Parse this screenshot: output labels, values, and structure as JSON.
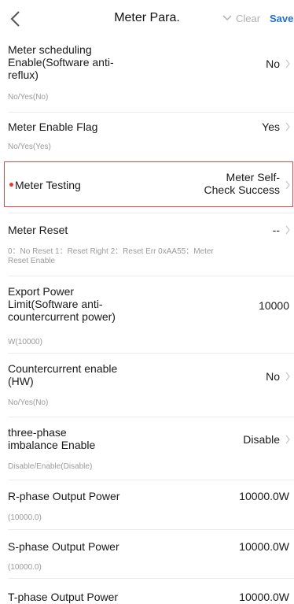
{
  "header": {
    "title": "Meter Para.",
    "clear_label": "Clear",
    "save_label": "Save",
    "back_icon": "chevron-left-icon",
    "dropdown_icon": "chevron-down-icon"
  },
  "rows": [
    {
      "label_lines": [
        "Meter scheduling",
        "Enable(Software anti-",
        "reflux)"
      ],
      "value": "No",
      "sub": "No/Yes(No)"
    },
    {
      "label_lines": [
        "Meter Enable Flag"
      ],
      "value": "Yes",
      "sub": "No/Yes(Yes)"
    },
    {
      "label_lines": [
        "Meter Testing"
      ],
      "value_lines": [
        "Meter Self-",
        "Check Success"
      ]
    },
    {
      "label_lines": [
        "Meter Reset"
      ],
      "value": "--",
      "sub_lines": [
        "0：No Reset 1：Reset Right  2：Reset Err 0xAA55：Meter",
        "Reset Enable"
      ]
    },
    {
      "label_lines": [
        "Export Power",
        "Limit(Software anti-",
        "countercurrent power)"
      ],
      "value": "10000",
      "sub": "W(10000)"
    },
    {
      "label_lines": [
        "Countercurrent enable",
        "(HW)"
      ],
      "value": "No",
      "sub": "No/Yes(No)"
    },
    {
      "label_lines": [
        "three-phase",
        "imbalance Enable"
      ],
      "value": "Disable",
      "sub": "Disable/Enable(Disable)"
    },
    {
      "label_lines": [
        "R-phase Output Power"
      ],
      "value": "10000.0W",
      "sub": "(10000.0)"
    },
    {
      "label_lines": [
        "S-phase Output Power"
      ],
      "value": "10000.0W",
      "sub": "(10000.0)"
    },
    {
      "label_lines": [
        "T-phase Output Power"
      ],
      "value": "10000.0W"
    }
  ],
  "colors": {
    "accent": "#1f6fd6",
    "muted": "#b0b0b0",
    "highlight_border": "#e04848",
    "required_dot": "#e53935"
  }
}
